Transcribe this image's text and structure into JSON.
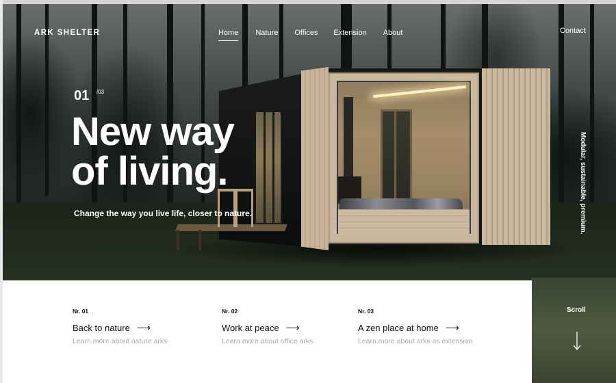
{
  "brand": {
    "logo": "ARK SHELTER"
  },
  "nav": {
    "items": [
      {
        "label": "Home",
        "active": true
      },
      {
        "label": "Nature",
        "active": false
      },
      {
        "label": "Offices",
        "active": false
      },
      {
        "label": "Extension",
        "active": false
      },
      {
        "label": "About",
        "active": false
      }
    ],
    "contact": "Contact"
  },
  "hero": {
    "counter": {
      "current": "01",
      "total": "/03"
    },
    "headline_line1": "New way",
    "headline_line2": "of living.",
    "subline": "Change the way you live life, closer to nature.",
    "vertical_tagline": "Modular, sustainable, premium."
  },
  "cards": [
    {
      "nr": "Nr. 01",
      "title": "Back to nature",
      "arrow": "⟶",
      "subtitle": "Learn more about nature arks"
    },
    {
      "nr": "Nr. 02",
      "title": "Work at peace",
      "arrow": "⟶",
      "subtitle": "Learn more about office arks"
    },
    {
      "nr": "Nr. 03",
      "title": "A zen place at home",
      "arrow": "⟶",
      "subtitle": "Learn more about arks as extension"
    }
  ],
  "scroll": {
    "label": "Scroll",
    "icon": "arrow-down-icon"
  },
  "colors": {
    "text_light": "#ffffff",
    "text_dark": "#111111",
    "muted": "#a7a7a7"
  }
}
